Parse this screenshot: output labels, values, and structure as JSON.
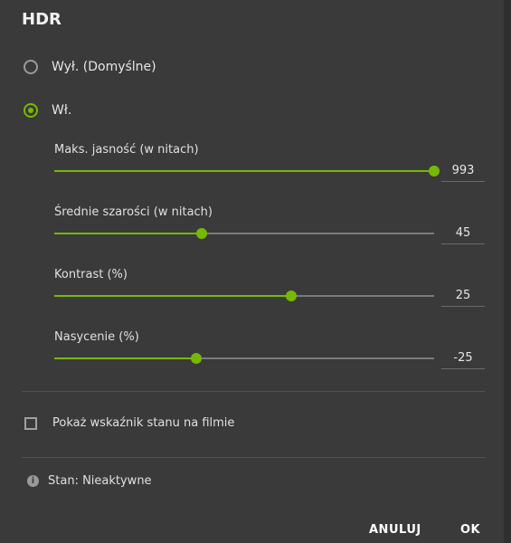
{
  "dialog": {
    "title": "HDR"
  },
  "options": {
    "off_label": "Wył. (Domyślne)",
    "on_label": "Wł.",
    "selected": "on"
  },
  "sliders": [
    {
      "label": "Maks. jasność (w nitach)",
      "value": "993",
      "fraction": 1.0
    },
    {
      "label": "Średnie szarości (w nitach)",
      "value": "45",
      "fraction": 0.388
    },
    {
      "label": "Kontrast (%)",
      "value": "25",
      "fraction": 0.624
    },
    {
      "label": "Nasycenie (%)",
      "value": "-25",
      "fraction": 0.374
    }
  ],
  "checkbox": {
    "label": "Pokaż wskaźnik stanu na filmie",
    "checked": false
  },
  "status": {
    "icon": "info-icon",
    "text": "Stan: Nieaktywne"
  },
  "buttons": {
    "cancel": "ANULUJ",
    "ok": "OK"
  },
  "colors": {
    "accent": "#76b900",
    "background": "#3a3a3a"
  }
}
